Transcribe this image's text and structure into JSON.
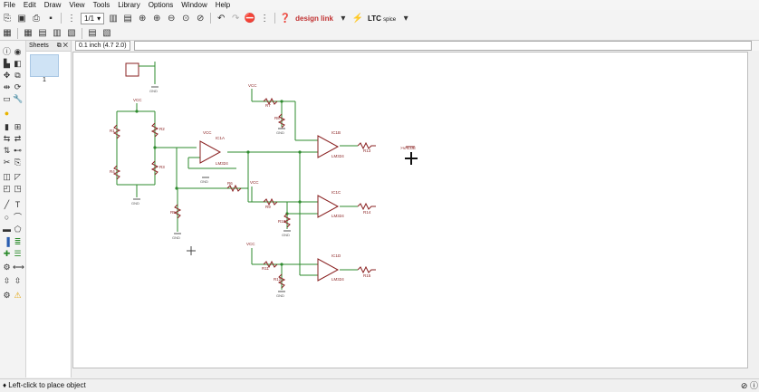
{
  "menu": [
    "File",
    "Edit",
    "Draw",
    "View",
    "Tools",
    "Library",
    "Options",
    "Window",
    "Help"
  ],
  "toolbar": {
    "zoom_value": "1/1",
    "brand1": "design link",
    "brand2": "LTC",
    "brand2_sub": "spice"
  },
  "sheets": {
    "title": "Sheets",
    "page": "1"
  },
  "coords": "0.1 inch (4.7 2.0)",
  "status": "♦ Left-click to place object",
  "schematic": {
    "labels": {
      "vcc1": "VCC",
      "vcc2": "VCC",
      "vcc3": "VCC",
      "vcc4": "VCC",
      "vcc5": "VCC",
      "ic1a": "IC1A",
      "ic1b": "IC1B",
      "ic1c": "IC1C",
      "ic1d": "IC1D",
      "part1": "LM324",
      "part2": "LM324",
      "part3": "LM324",
      "part4": "LM324",
      "value": ">VALUE",
      "r1": "R1",
      "r2": "R2",
      "r3": "R3",
      "r4": "R4",
      "r5": "R5",
      "r6": "R6",
      "r7": "R7",
      "r8": "R8",
      "r9": "R9",
      "r10": "R10",
      "r11": "R11",
      "r12": "R12",
      "r13": "R13",
      "r14": "R14",
      "r15": "R15",
      "gnd": "GND"
    }
  }
}
